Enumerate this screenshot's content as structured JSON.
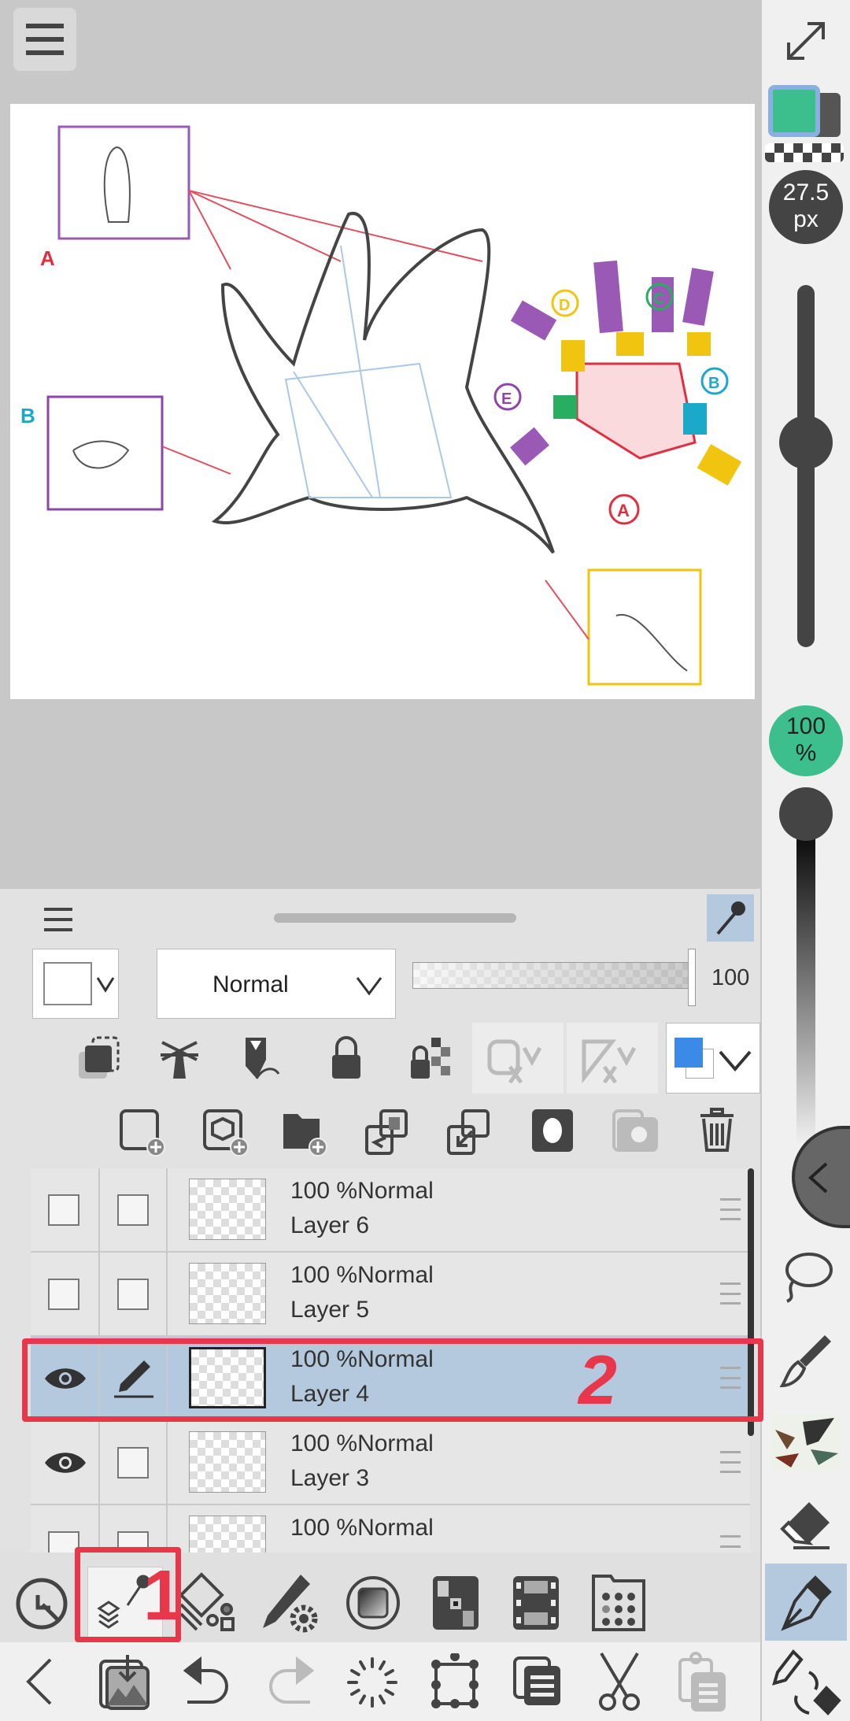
{
  "canvas": {
    "labels": {
      "a": "A",
      "b": "B"
    },
    "hand_labels": [
      "A",
      "B",
      "C",
      "D",
      "E"
    ]
  },
  "rail": {
    "brush_size": "27.5",
    "brush_unit": "px",
    "opacity_value": "100",
    "opacity_unit": "%",
    "brush_size_level": 0.55,
    "opacity_level": 1.0,
    "main_color": "#3cbf8d"
  },
  "panel": {
    "blend_mode": "Normal",
    "opacity": "100",
    "opacity_level": 1.0,
    "layers": [
      {
        "opacity_mode": "100 %Normal",
        "name": "Layer 6",
        "visible": false,
        "selected": false
      },
      {
        "opacity_mode": "100 %Normal",
        "name": "Layer 5",
        "visible": false,
        "selected": false
      },
      {
        "opacity_mode": "100 %Normal",
        "name": "Layer 4",
        "visible": true,
        "selected": true
      },
      {
        "opacity_mode": "100 %Normal",
        "name": "Layer 3",
        "visible": true,
        "selected": false
      },
      {
        "opacity_mode": "100 %Normal",
        "name": "",
        "visible": false,
        "selected": false
      }
    ]
  },
  "annotations": {
    "one": "1",
    "two": "2",
    "color": "#e8374a"
  },
  "colors": {
    "accent": "#b4c9de",
    "layer_color": "#3b8ae8"
  }
}
